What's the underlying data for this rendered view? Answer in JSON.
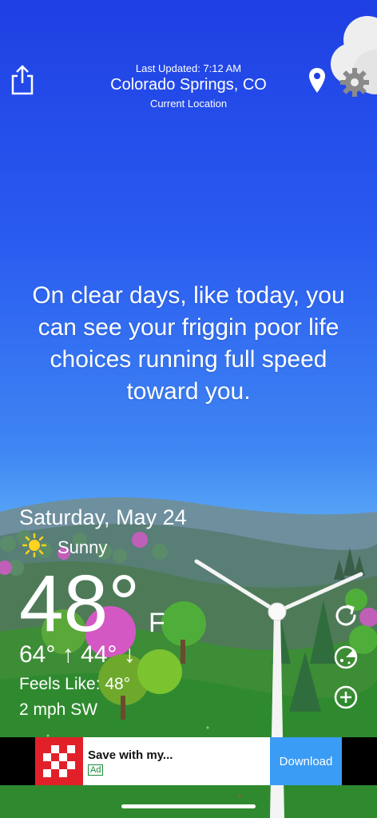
{
  "header": {
    "last_updated": "Last Updated: 7:12 AM",
    "city": "Colorado Springs, CO",
    "location_label": "Current Location"
  },
  "icons": {
    "share": "share-icon",
    "location": "location-pin-icon",
    "settings": "gear-icon",
    "refresh": "refresh-icon",
    "radar": "radar-icon",
    "add": "plus-circle-icon",
    "condition": "sun-icon"
  },
  "quote": "On clear days, like today, you can see your friggin poor life choices running full speed toward you.",
  "weather": {
    "date": "Saturday, May 24",
    "condition": "Sunny",
    "temperature": "48°",
    "unit": "F",
    "hi_lo": "64° ↑  44° ↓",
    "feels_like": "Feels Like: 48°",
    "wind": "2 mph SW"
  },
  "ad": {
    "title": "Save with my...",
    "badge": "Ad",
    "cta": "Download"
  },
  "colors": {
    "sky_top": "#1f3fe3",
    "sky_bottom": "#6fb6f4",
    "grass": "#2f8a2f",
    "ad_button": "#3b9cf5",
    "ad_logo": "#e2202a"
  }
}
